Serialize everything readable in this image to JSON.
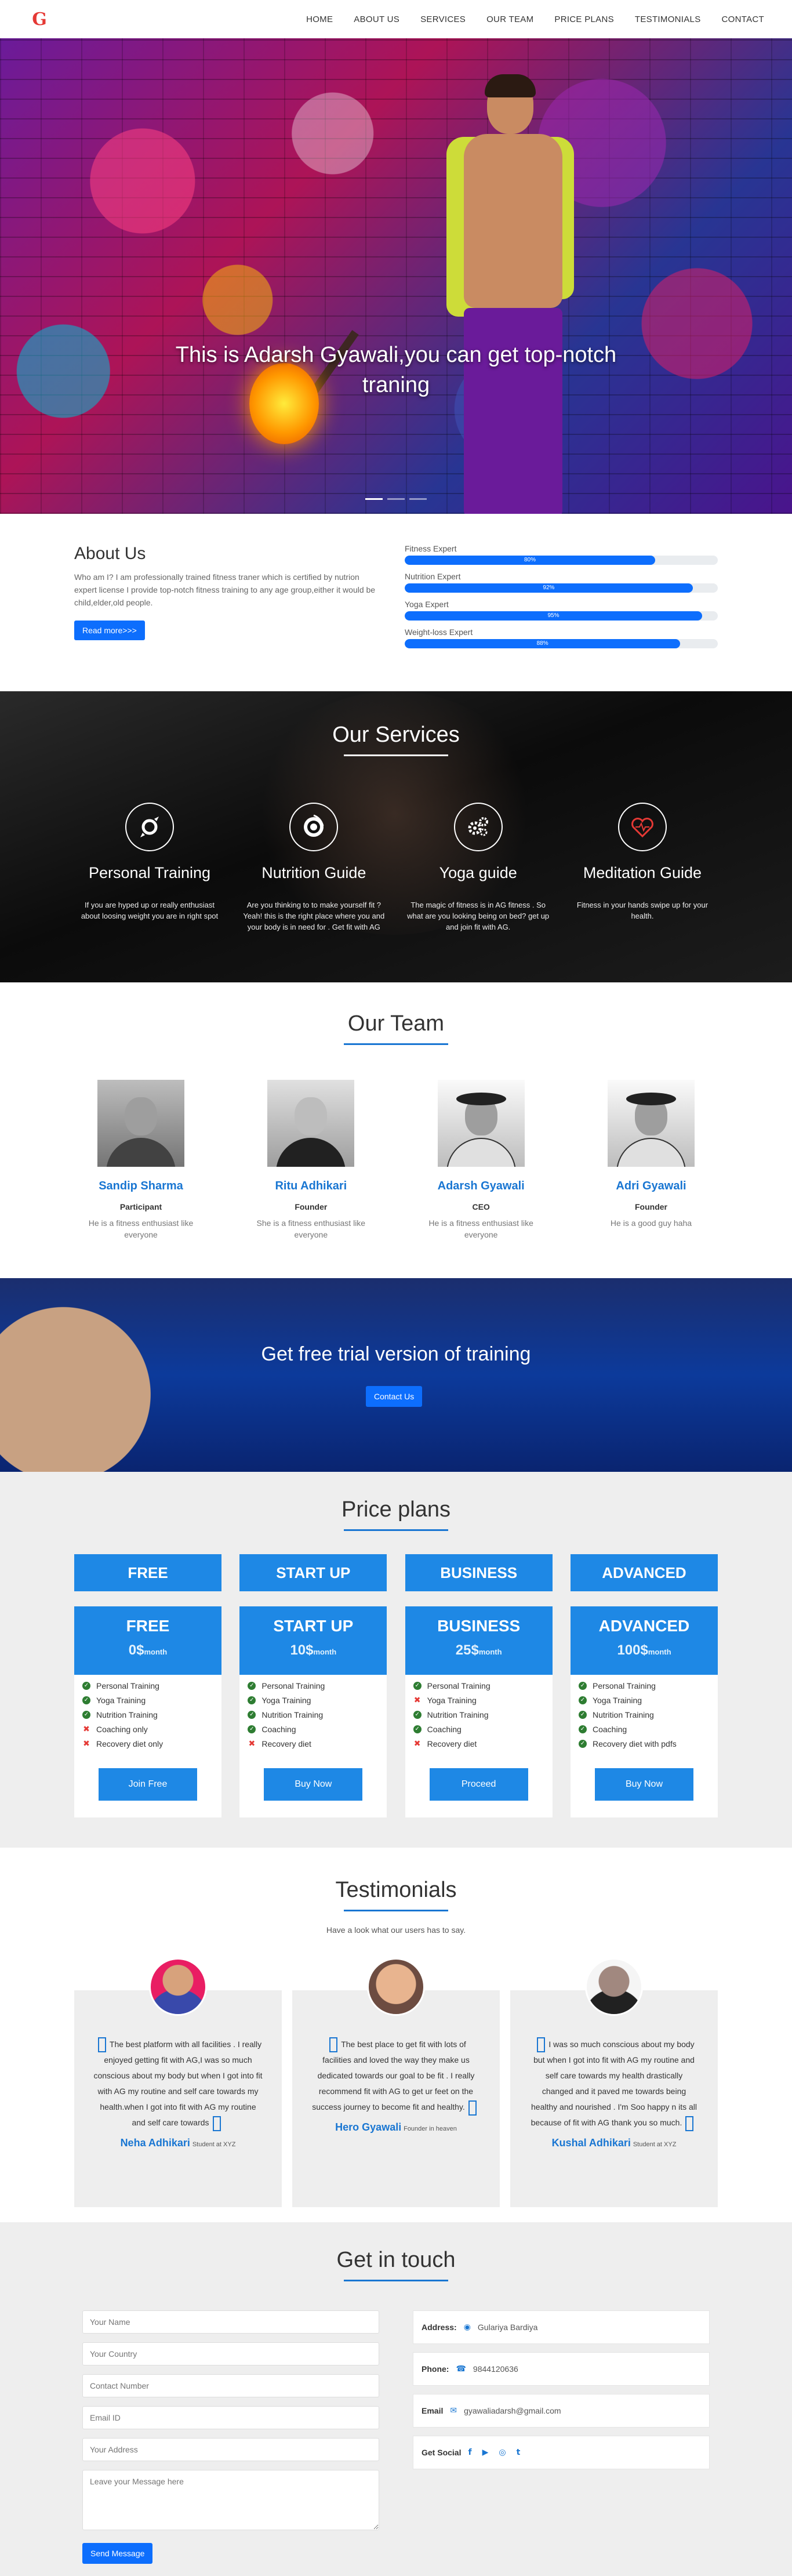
{
  "nav": {
    "logo": "G",
    "links": [
      "HOME",
      "ABOUT US",
      "SERVICES",
      "OUR TEAM",
      "PRICE PLANS",
      "TESTIMONIALS",
      "CONTACT"
    ]
  },
  "hero": {
    "headline": "This is Adarsh Gyawali,you can get top-notch traning",
    "slide_count": 3,
    "active_slide": 1
  },
  "about": {
    "title": "About Us",
    "text": "Who am I? I am professionally trained fitness traner which is certified by nutrion expert license I provide top-notch fitness training to any age group,either it would be child,elder,old people.",
    "button": "Read more>>>",
    "skills": [
      {
        "label": "Fitness Expert",
        "value_text": "80%",
        "percent": 80
      },
      {
        "label": "Nutrition Expert",
        "value_text": "92%",
        "percent": 92
      },
      {
        "label": "Yoga Expert",
        "value_text": "95%",
        "percent": 95
      },
      {
        "label": "Weight-loss Expert",
        "value_text": "88%",
        "percent": 88
      }
    ]
  },
  "services": {
    "title": "Our Services",
    "items": [
      {
        "icon": "personal-training-icon",
        "title": "Personal Training",
        "text": "If you are hyped up or really enthusiast about loosing weight you are in right spot"
      },
      {
        "icon": "nutrition-icon",
        "title": "Nutrition Guide",
        "text": "Are you thinking to to make yourself fit ? Yeah! this is the right place where you and your body is in need for . Get fit with AG"
      },
      {
        "icon": "yoga-gears-icon",
        "title": "Yoga guide",
        "text": "The magic of fitness is in AG fitness . So what are you looking being on bed? get up and join fit with AG."
      },
      {
        "icon": "heart-icon",
        "title": "Meditation Guide",
        "text": "Fitness in your hands swipe up for your health."
      }
    ]
  },
  "team": {
    "title": "Our Team",
    "members": [
      {
        "name": "Sandip Sharma",
        "role": "Participant",
        "desc": "He is a fitness enthusiast like everyone"
      },
      {
        "name": "Ritu Adhikari",
        "role": "Founder",
        "desc": "She is a fitness enthusiast like everyone"
      },
      {
        "name": "Adarsh Gyawali",
        "role": "CEO",
        "desc": "He is a fitness enthusiast like everyone"
      },
      {
        "name": "Adri Gyawali",
        "role": "Founder",
        "desc": "He is a good guy haha"
      }
    ]
  },
  "trial": {
    "text": "Get free trial version of training",
    "button": "Contact Us"
  },
  "price": {
    "title": "Price plans",
    "plans": [
      {
        "header": "FREE",
        "title": "FREE",
        "amount": "0$",
        "period": "month",
        "button": "Join Free",
        "features": [
          {
            "text": "Personal Training",
            "ok": true
          },
          {
            "text": "Yoga Training",
            "ok": true
          },
          {
            "text": "Nutrition Training",
            "ok": true
          },
          {
            "text": "Coaching only",
            "ok": false
          },
          {
            "text": "Recovery diet only",
            "ok": false
          }
        ]
      },
      {
        "header": "START UP",
        "title": "START UP",
        "amount": "10$",
        "period": "month",
        "button": "Buy Now",
        "features": [
          {
            "text": "Personal Training",
            "ok": true
          },
          {
            "text": "Yoga Training",
            "ok": true
          },
          {
            "text": "Nutrition Training",
            "ok": true
          },
          {
            "text": "Coaching",
            "ok": true
          },
          {
            "text": "Recovery diet",
            "ok": false
          }
        ]
      },
      {
        "header": "BUSINESS",
        "title": "BUSINESS",
        "amount": "25$",
        "period": "month",
        "button": "Proceed",
        "features": [
          {
            "text": "Personal Training",
            "ok": true
          },
          {
            "text": "Yoga Training",
            "ok": false
          },
          {
            "text": "Nutrition Training",
            "ok": true
          },
          {
            "text": "Coaching",
            "ok": true
          },
          {
            "text": "Recovery diet",
            "ok": false
          }
        ]
      },
      {
        "header": "ADVANCED",
        "title": "ADVANCED",
        "amount": "100$",
        "period": "month",
        "button": "Buy Now",
        "features": [
          {
            "text": "Personal Training",
            "ok": true
          },
          {
            "text": "Yoga Training",
            "ok": true
          },
          {
            "text": "Nutrition Training",
            "ok": true
          },
          {
            "text": "Coaching",
            "ok": true
          },
          {
            "text": "Recovery diet with pdfs",
            "ok": true
          }
        ]
      }
    ]
  },
  "testimonials": {
    "title": "Testimonials",
    "subtitle": "Have a look what our users has to say.",
    "items": [
      {
        "quote": "The best platform with all facilities . I really enjoyed getting fit with AG,I was so much conscious about my body but when I got into fit with AG my routine and self care towards my health.when I got into fit with AG my routine and self care towards",
        "name": "Neha Adhikari",
        "title": "Student at XYZ"
      },
      {
        "quote": "The best place to get fit with lots of facilities and loved the way they make us dedicated towards our goal to be fit . I really recommend fit with AG to get ur feet on the success journey to become fit and healthy.",
        "name": "Hero Gyawali",
        "title": "Founder in heaven"
      },
      {
        "quote": "I was so much conscious about my body but when I got into fit with AG my routine and self care towards my health drastically changed and it paved me towards being healthy and nourished . I'm Soo happy n its all because of fit with AG thank you so much.",
        "name": "Kushal Adhikari",
        "title": "Student at XYZ"
      }
    ]
  },
  "contact": {
    "title": "Get in touch",
    "placeholders": {
      "name": "Your Name",
      "country": "Your Country",
      "number": "Contact Number",
      "email": "Email ID",
      "address": "Your Address",
      "message": "Leave your Message here"
    },
    "button": "Send Message",
    "address_label": "Address:",
    "address_value": "Gulariya Bardiya",
    "phone_label": "Phone:",
    "phone_value": "9844120636",
    "email_label": "Email",
    "email_value": "gyawaliadarsh@gmail.com",
    "social_label": "Get Social",
    "social_icons": [
      "f",
      "▶",
      "◎",
      "t"
    ]
  },
  "colors": {
    "accent": "#1976d2",
    "button": "#0d6efd",
    "price_blue": "#1e88e5",
    "check": "#2e7d32",
    "cross": "#e53935"
  }
}
